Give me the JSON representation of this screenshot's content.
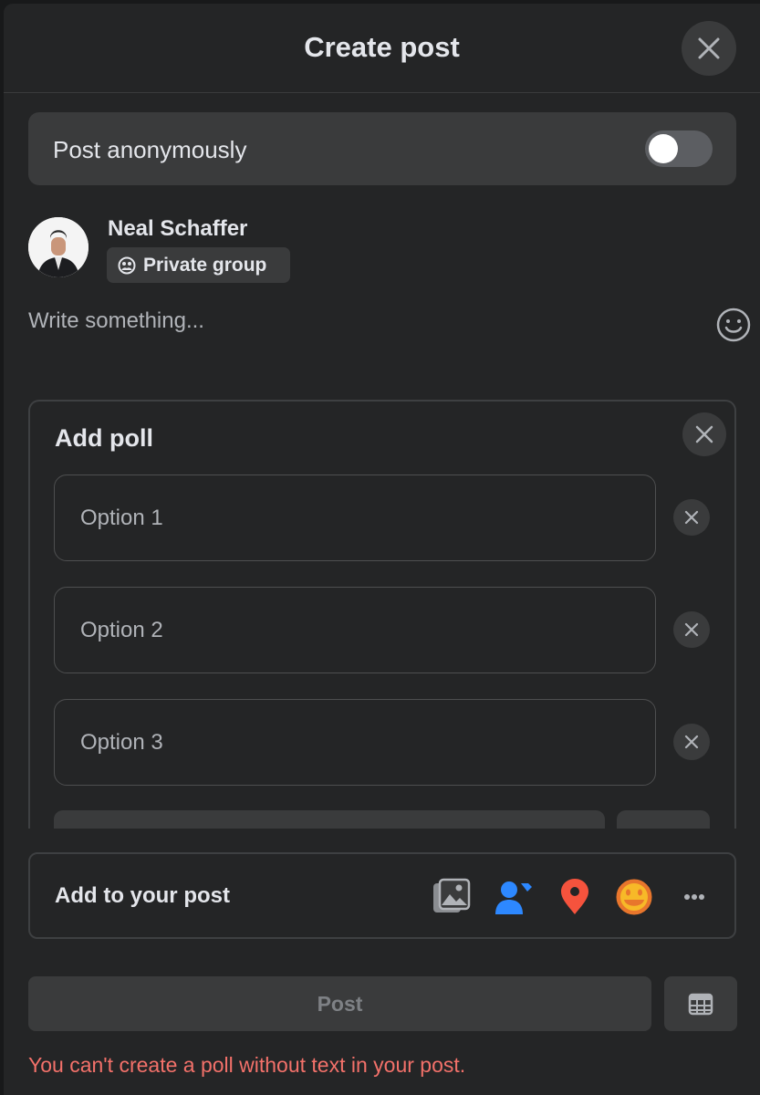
{
  "header": {
    "title": "Create post"
  },
  "anonymous": {
    "label": "Post anonymously",
    "enabled": false
  },
  "author": {
    "name": "Neal Schaffer",
    "privacy": "Private group"
  },
  "composer": {
    "placeholder": "Write something..."
  },
  "poll": {
    "title": "Add poll",
    "options": [
      {
        "placeholder": "Option 1"
      },
      {
        "placeholder": "Option 2"
      },
      {
        "placeholder": "Option 3"
      }
    ]
  },
  "add_to_post": {
    "label": "Add to your post",
    "icons": [
      "photo-video-icon",
      "tag-people-icon",
      "check-in-icon",
      "feeling-icon",
      "more-icon"
    ],
    "colors": {
      "tag": "#2d88ff",
      "checkin": "#f5533d",
      "feeling": "#f7b928"
    }
  },
  "post_button": {
    "label": "Post"
  },
  "error": {
    "message": "You can't create a poll without text in your post."
  }
}
